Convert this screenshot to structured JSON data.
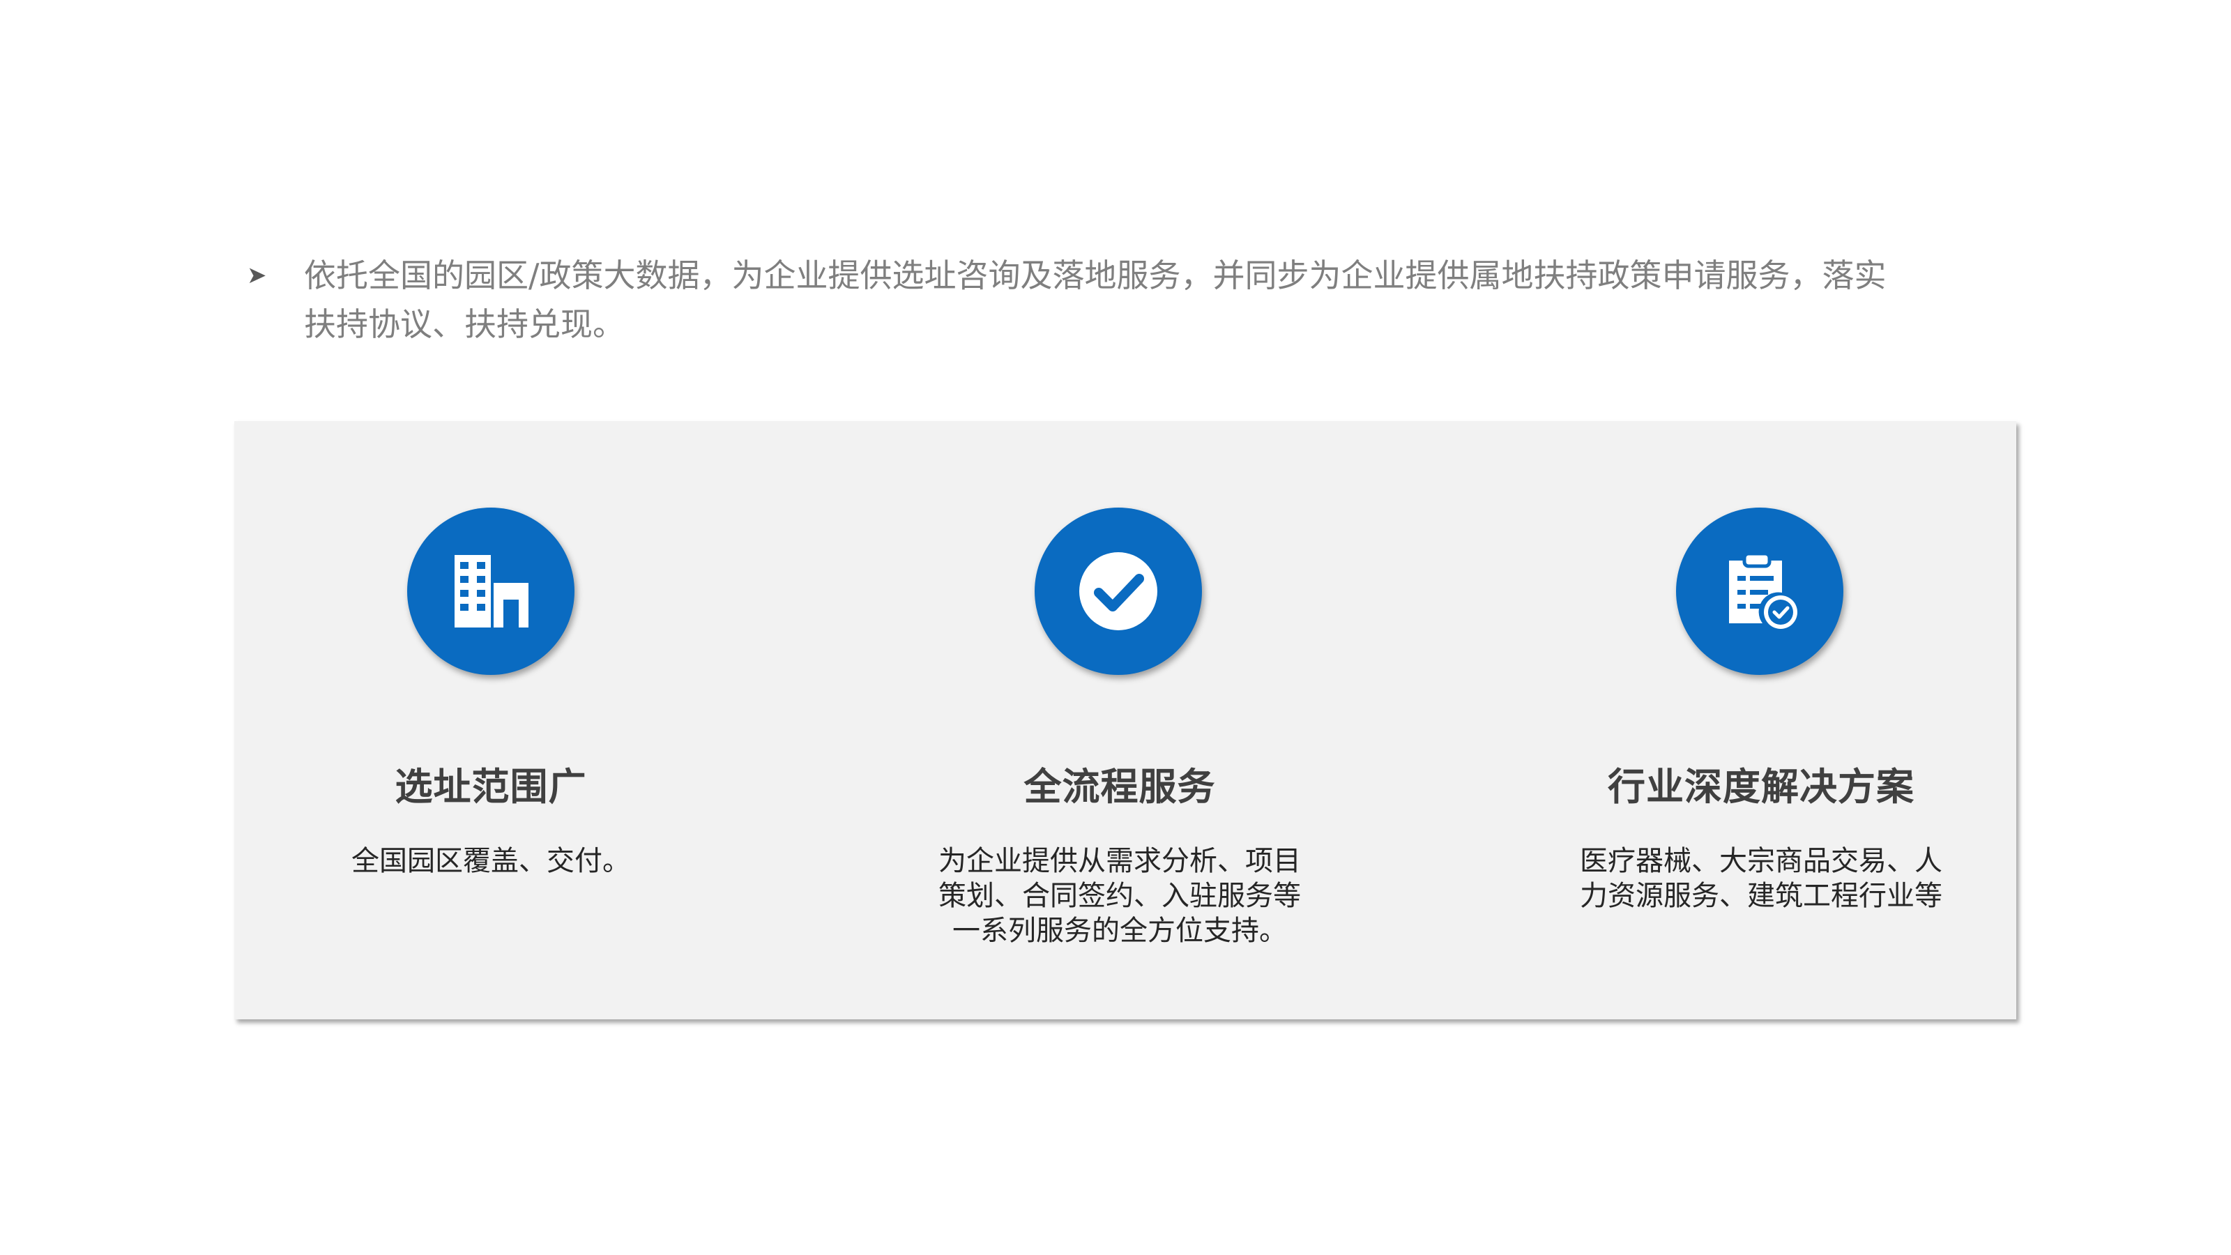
{
  "intro": {
    "bullet_icon": "arrowhead-bullet",
    "text": "依托全国的园区/政策大数据，为企业提供选址咨询及落地服务，并同步为企业提供属地扶持政策申请服务，落实扶持协议、扶持兑现。"
  },
  "colors": {
    "accent": "#0a6bc1",
    "panel_bg": "#f2f2f2",
    "intro_text": "#7f7f7f",
    "title_text": "#404040"
  },
  "features": [
    {
      "icon": "building-icon",
      "title": "选址范围广",
      "desc": "全国园区覆盖、交付。"
    },
    {
      "icon": "check-circle-icon",
      "title": "全流程服务",
      "desc": "为企业提供从需求分析、项目策划、合同签约、入驻服务等一系列服务的全方位支持。"
    },
    {
      "icon": "clipboard-check-icon",
      "title": "行业深度解决方案",
      "desc": "医疗器械、大宗商品交易、人力资源服务、建筑工程行业等"
    }
  ]
}
